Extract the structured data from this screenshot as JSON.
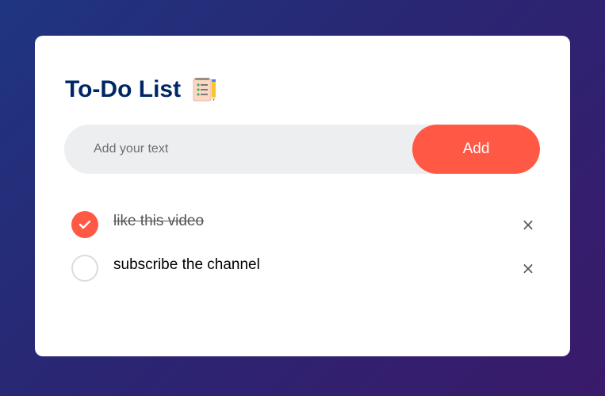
{
  "app": {
    "title": "To-Do List",
    "title_icon": "notepad-checklist-emoji"
  },
  "input": {
    "placeholder": "Add your text",
    "value": ""
  },
  "add_button": {
    "label": "Add"
  },
  "tasks": [
    {
      "text": "like this video",
      "checked": true,
      "delete_label": "×"
    },
    {
      "text": "subscribe the channel",
      "checked": false,
      "delete_label": "×"
    }
  ],
  "colors": {
    "accent": "#ff5945",
    "title": "#002765",
    "input_bg": "#edeef0"
  }
}
